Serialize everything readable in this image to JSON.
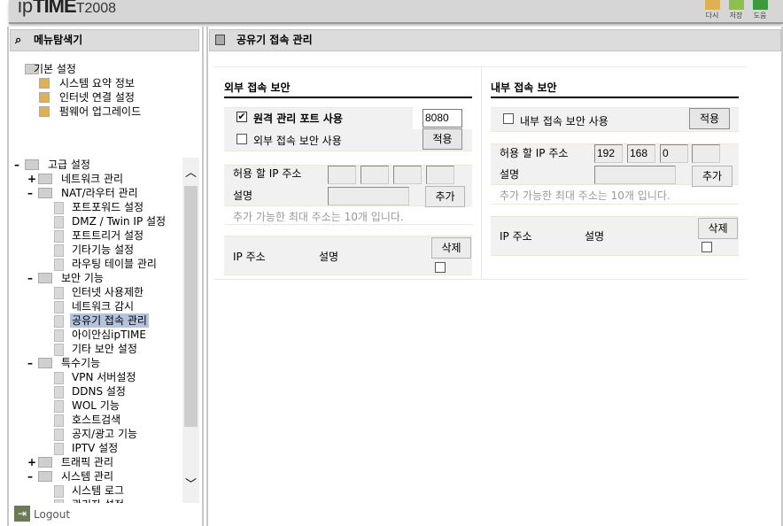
{
  "header": {
    "logo": "ipTIME",
    "model": "T2008",
    "buttons": [
      {
        "label": "다시",
        "color": "#e0b055"
      },
      {
        "label": "저장",
        "color": "#8cc04a"
      },
      {
        "label": "도움",
        "color": "#3c9a3c"
      }
    ]
  },
  "sidebar": {
    "title": "메뉴탐색기",
    "basic": {
      "label": "기본 설정",
      "items": [
        "시스템 요약 정보",
        "인터넷 연결 설정",
        "펌웨어 업그레이드"
      ]
    },
    "tree": [
      {
        "label": "고급 설정",
        "level": 0,
        "exp": "-"
      },
      {
        "label": "네트워크 관리",
        "level": 1,
        "exp": "+"
      },
      {
        "label": "NAT/라우터 관리",
        "level": 1,
        "exp": "-"
      },
      {
        "label": "포트포워드 설정",
        "level": 2
      },
      {
        "label": "DMZ / Twin IP 설정",
        "level": 2
      },
      {
        "label": "포트트리거 설정",
        "level": 2
      },
      {
        "label": "기타기능 설정",
        "level": 2
      },
      {
        "label": "라우팅 테이블 관리",
        "level": 2
      },
      {
        "label": "보안 기능",
        "level": 1,
        "exp": "-"
      },
      {
        "label": "인터넷 사용제한",
        "level": 2
      },
      {
        "label": "네트워크 감시",
        "level": 2
      },
      {
        "label": "공유기 접속 관리",
        "level": 2,
        "selected": true
      },
      {
        "label": "아이안심ipTIME",
        "level": 2
      },
      {
        "label": "기타 보안 설정",
        "level": 2
      },
      {
        "label": "특수기능",
        "level": 1,
        "exp": "-"
      },
      {
        "label": "VPN 서버설정",
        "level": 2
      },
      {
        "label": "DDNS 설정",
        "level": 2
      },
      {
        "label": "WOL 기능",
        "level": 2
      },
      {
        "label": "호스트검색",
        "level": 2
      },
      {
        "label": "공지/광고 기능",
        "level": 2
      },
      {
        "label": "IPTV 설정",
        "level": 2
      },
      {
        "label": "트래픽 관리",
        "level": 1,
        "exp": "+"
      },
      {
        "label": "시스템 관리",
        "level": 1,
        "exp": "-"
      },
      {
        "label": "시스템 로그",
        "level": 2
      },
      {
        "label": "관리자 설정",
        "level": 2
      }
    ],
    "logout": "Logout"
  },
  "main": {
    "title": "공유기 접속 관리",
    "external": {
      "title": "외부 접속 보안",
      "remote_port_label": "원격 관리 포트 사용",
      "remote_port_checked": true,
      "remote_port": "8080",
      "use_label": "외부 접속 보안 사용",
      "use_checked": false,
      "apply": "적용",
      "ip_label": "허용 할 IP 주소",
      "ip": [
        "",
        "",
        "",
        ""
      ],
      "desc_label": "설명",
      "desc": "",
      "add": "추가",
      "note": "추가 가능한 최대 주소는 10개 입니다.",
      "col_ip": "IP 주소",
      "col_desc": "설명",
      "delete": "삭제"
    },
    "internal": {
      "title": "내부 접속 보안",
      "use_label": "내부 접속 보안 사용",
      "use_checked": false,
      "apply": "적용",
      "ip_label": "허용 할 IP 주소",
      "ip": [
        "192",
        "168",
        "0",
        ""
      ],
      "desc_label": "설명",
      "desc": "",
      "add": "추가",
      "note": "추가 가능한 최대 주소는 10개 입니다.",
      "col_ip": "IP 주소",
      "col_desc": "설명",
      "delete": "삭제"
    }
  }
}
